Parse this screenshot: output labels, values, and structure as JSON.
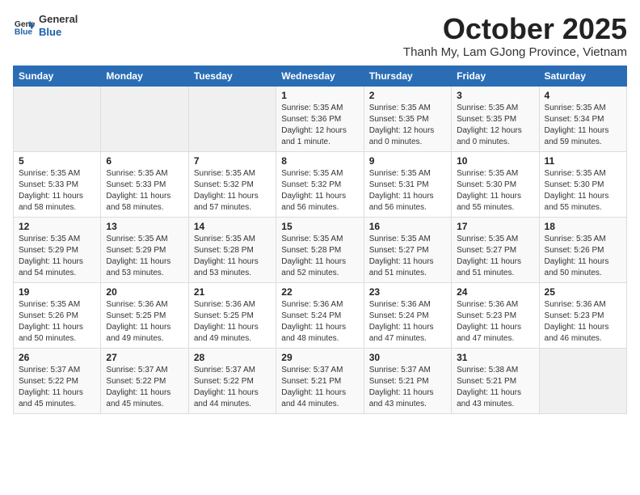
{
  "logo": {
    "line1": "General",
    "line2": "Blue"
  },
  "title": "October 2025",
  "subtitle": "Thanh My, Lam GJong Province, Vietnam",
  "days_of_week": [
    "Sunday",
    "Monday",
    "Tuesday",
    "Wednesday",
    "Thursday",
    "Friday",
    "Saturday"
  ],
  "weeks": [
    [
      {
        "day": "",
        "info": ""
      },
      {
        "day": "",
        "info": ""
      },
      {
        "day": "",
        "info": ""
      },
      {
        "day": "1",
        "info": "Sunrise: 5:35 AM\nSunset: 5:36 PM\nDaylight: 12 hours\nand 1 minute."
      },
      {
        "day": "2",
        "info": "Sunrise: 5:35 AM\nSunset: 5:35 PM\nDaylight: 12 hours\nand 0 minutes."
      },
      {
        "day": "3",
        "info": "Sunrise: 5:35 AM\nSunset: 5:35 PM\nDaylight: 12 hours\nand 0 minutes."
      },
      {
        "day": "4",
        "info": "Sunrise: 5:35 AM\nSunset: 5:34 PM\nDaylight: 11 hours\nand 59 minutes."
      }
    ],
    [
      {
        "day": "5",
        "info": "Sunrise: 5:35 AM\nSunset: 5:33 PM\nDaylight: 11 hours\nand 58 minutes."
      },
      {
        "day": "6",
        "info": "Sunrise: 5:35 AM\nSunset: 5:33 PM\nDaylight: 11 hours\nand 58 minutes."
      },
      {
        "day": "7",
        "info": "Sunrise: 5:35 AM\nSunset: 5:32 PM\nDaylight: 11 hours\nand 57 minutes."
      },
      {
        "day": "8",
        "info": "Sunrise: 5:35 AM\nSunset: 5:32 PM\nDaylight: 11 hours\nand 56 minutes."
      },
      {
        "day": "9",
        "info": "Sunrise: 5:35 AM\nSunset: 5:31 PM\nDaylight: 11 hours\nand 56 minutes."
      },
      {
        "day": "10",
        "info": "Sunrise: 5:35 AM\nSunset: 5:30 PM\nDaylight: 11 hours\nand 55 minutes."
      },
      {
        "day": "11",
        "info": "Sunrise: 5:35 AM\nSunset: 5:30 PM\nDaylight: 11 hours\nand 55 minutes."
      }
    ],
    [
      {
        "day": "12",
        "info": "Sunrise: 5:35 AM\nSunset: 5:29 PM\nDaylight: 11 hours\nand 54 minutes."
      },
      {
        "day": "13",
        "info": "Sunrise: 5:35 AM\nSunset: 5:29 PM\nDaylight: 11 hours\nand 53 minutes."
      },
      {
        "day": "14",
        "info": "Sunrise: 5:35 AM\nSunset: 5:28 PM\nDaylight: 11 hours\nand 53 minutes."
      },
      {
        "day": "15",
        "info": "Sunrise: 5:35 AM\nSunset: 5:28 PM\nDaylight: 11 hours\nand 52 minutes."
      },
      {
        "day": "16",
        "info": "Sunrise: 5:35 AM\nSunset: 5:27 PM\nDaylight: 11 hours\nand 51 minutes."
      },
      {
        "day": "17",
        "info": "Sunrise: 5:35 AM\nSunset: 5:27 PM\nDaylight: 11 hours\nand 51 minutes."
      },
      {
        "day": "18",
        "info": "Sunrise: 5:35 AM\nSunset: 5:26 PM\nDaylight: 11 hours\nand 50 minutes."
      }
    ],
    [
      {
        "day": "19",
        "info": "Sunrise: 5:35 AM\nSunset: 5:26 PM\nDaylight: 11 hours\nand 50 minutes."
      },
      {
        "day": "20",
        "info": "Sunrise: 5:36 AM\nSunset: 5:25 PM\nDaylight: 11 hours\nand 49 minutes."
      },
      {
        "day": "21",
        "info": "Sunrise: 5:36 AM\nSunset: 5:25 PM\nDaylight: 11 hours\nand 49 minutes."
      },
      {
        "day": "22",
        "info": "Sunrise: 5:36 AM\nSunset: 5:24 PM\nDaylight: 11 hours\nand 48 minutes."
      },
      {
        "day": "23",
        "info": "Sunrise: 5:36 AM\nSunset: 5:24 PM\nDaylight: 11 hours\nand 47 minutes."
      },
      {
        "day": "24",
        "info": "Sunrise: 5:36 AM\nSunset: 5:23 PM\nDaylight: 11 hours\nand 47 minutes."
      },
      {
        "day": "25",
        "info": "Sunrise: 5:36 AM\nSunset: 5:23 PM\nDaylight: 11 hours\nand 46 minutes."
      }
    ],
    [
      {
        "day": "26",
        "info": "Sunrise: 5:37 AM\nSunset: 5:22 PM\nDaylight: 11 hours\nand 45 minutes."
      },
      {
        "day": "27",
        "info": "Sunrise: 5:37 AM\nSunset: 5:22 PM\nDaylight: 11 hours\nand 45 minutes."
      },
      {
        "day": "28",
        "info": "Sunrise: 5:37 AM\nSunset: 5:22 PM\nDaylight: 11 hours\nand 44 minutes."
      },
      {
        "day": "29",
        "info": "Sunrise: 5:37 AM\nSunset: 5:21 PM\nDaylight: 11 hours\nand 44 minutes."
      },
      {
        "day": "30",
        "info": "Sunrise: 5:37 AM\nSunset: 5:21 PM\nDaylight: 11 hours\nand 43 minutes."
      },
      {
        "day": "31",
        "info": "Sunrise: 5:38 AM\nSunset: 5:21 PM\nDaylight: 11 hours\nand 43 minutes."
      },
      {
        "day": "",
        "info": ""
      }
    ]
  ]
}
